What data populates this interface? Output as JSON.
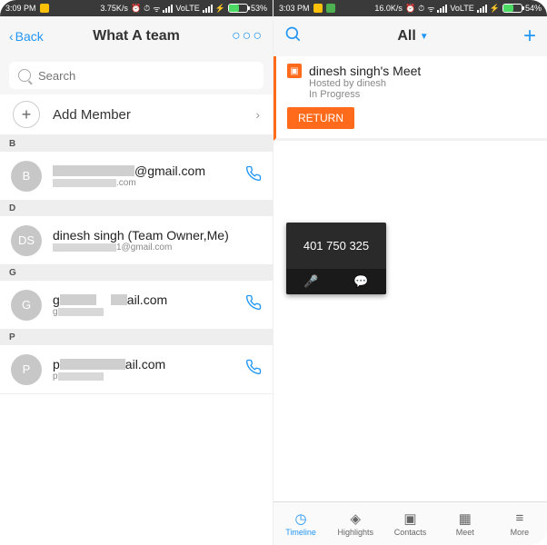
{
  "left": {
    "status": {
      "time": "3:09 PM",
      "speed": "3.75K/s",
      "volte": "VoLTE",
      "battery": "53%"
    },
    "header": {
      "back": "Back",
      "title": "What A team",
      "more": "○○○"
    },
    "search": {
      "placeholder": "Search"
    },
    "add_member": {
      "label": "Add Member"
    },
    "sections": {
      "b": {
        "letter": "B",
        "avatar": "B",
        "name_tail": "@gmail.com",
        "sub_tail": ".com"
      },
      "d": {
        "letter": "D",
        "avatar": "DS",
        "name": "dinesh singh (Team Owner,Me)",
        "sub_tail": "1@gmail.com"
      },
      "g": {
        "letter": "G",
        "avatar": "G",
        "name_head": "g",
        "name_tail": "ail.com",
        "sub_head": "g"
      },
      "p": {
        "letter": "P",
        "avatar": "P",
        "name_head": "p",
        "name_tail": "ail.com",
        "sub_head": "p"
      }
    }
  },
  "right": {
    "status": {
      "time": "3:03 PM",
      "speed": "16.0K/s",
      "volte": "VoLTE",
      "battery": "54%"
    },
    "header": {
      "title": "All"
    },
    "card": {
      "title": "dinesh singh's Meet",
      "host": "Hosted by dinesh",
      "state": "In Progress",
      "button": "RETURN"
    },
    "float": {
      "code": "401 750 325"
    },
    "nav": {
      "timeline": "Timeline",
      "highlights": "Highlights",
      "contacts": "Contacts",
      "meet": "Meet",
      "more": "More"
    }
  }
}
